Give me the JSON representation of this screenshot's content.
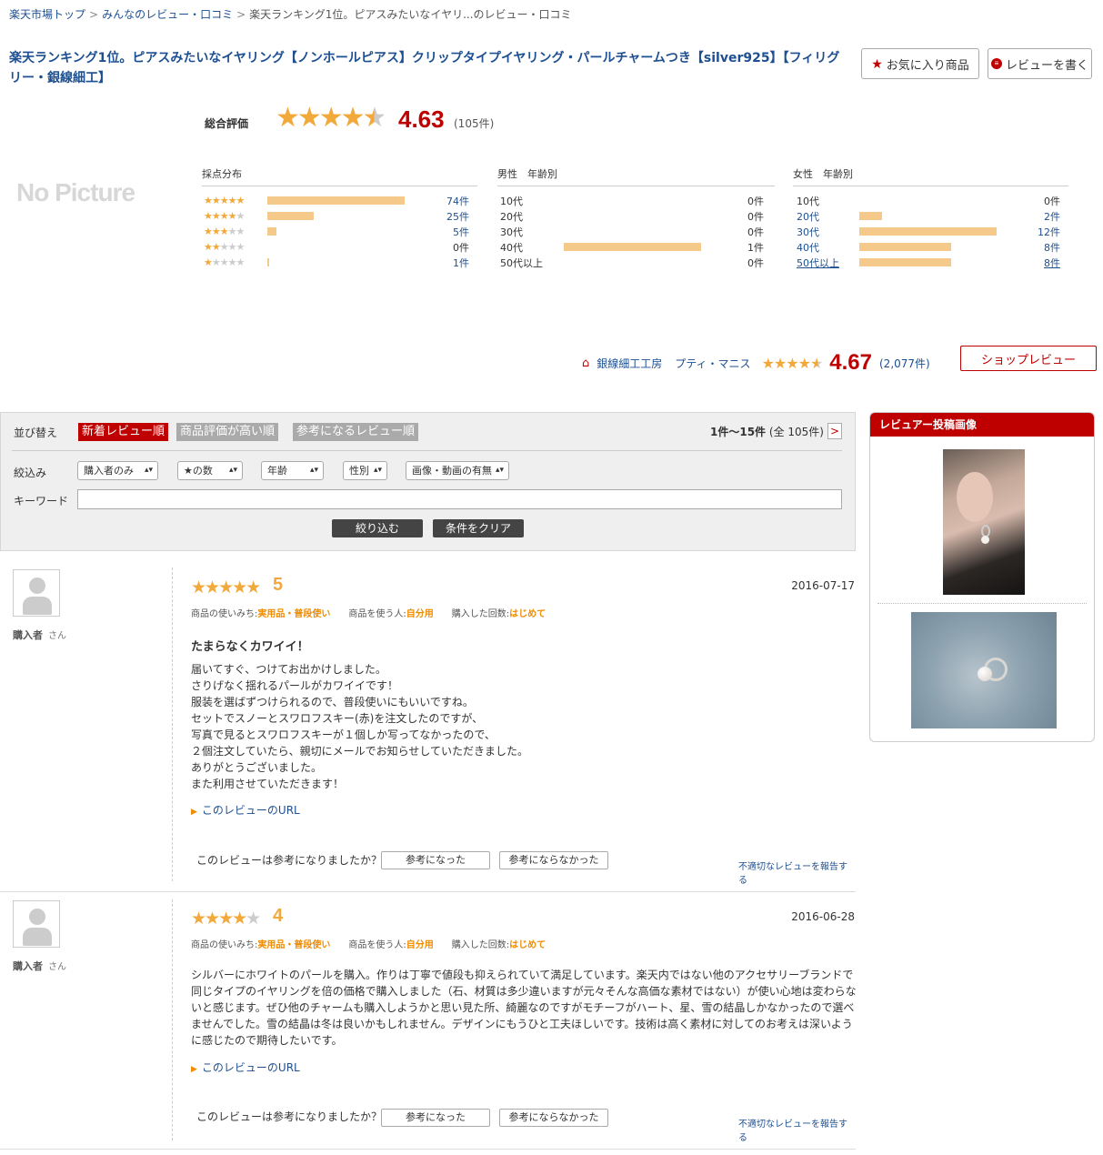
{
  "breadcrumb": {
    "home": "楽天市場トップ",
    "reviews": "みんなのレビュー・口コミ",
    "current": "楽天ランキング1位。ピアスみたいなイヤリ...のレビュー・口コミ",
    "separator": ">"
  },
  "product": {
    "title": "楽天ランキング1位。ピアスみたいなイヤリング【ノンホールピアス】クリップタイプイヤリング・パールチャームつき【silver925】【フィリグリー・銀線細工】",
    "no_picture": "No Picture",
    "fav_label": "お気に入り商品",
    "write_label": "レビューを書く"
  },
  "overall": {
    "label": "総合評価",
    "rating": 4.63,
    "score_text": "4.63",
    "count_text": "(105件)"
  },
  "distribution": {
    "title": "採点分布",
    "rows": [
      {
        "stars": 5,
        "count": "74件",
        "value": 74
      },
      {
        "stars": 4,
        "count": "25件",
        "value": 25
      },
      {
        "stars": 3,
        "count": "5件",
        "value": 5
      },
      {
        "stars": 2,
        "count": "0件",
        "value": 0
      },
      {
        "stars": 1,
        "count": "1件",
        "value": 1
      }
    ]
  },
  "male": {
    "title": "男性　年齢別",
    "rows": [
      {
        "age": "10代",
        "count": "0件",
        "value": 0
      },
      {
        "age": "20代",
        "count": "0件",
        "value": 0
      },
      {
        "age": "30代",
        "count": "0件",
        "value": 0
      },
      {
        "age": "40代",
        "count": "1件",
        "value": 1
      },
      {
        "age": "50代以上",
        "count": "0件",
        "value": 0
      }
    ]
  },
  "female": {
    "title": "女性　年齢別",
    "rows": [
      {
        "age": "10代",
        "count": "0件",
        "value": 0
      },
      {
        "age": "20代",
        "count": "2件",
        "value": 2
      },
      {
        "age": "30代",
        "count": "12件",
        "value": 12
      },
      {
        "age": "40代",
        "count": "8件",
        "value": 8
      },
      {
        "age": "50代以上",
        "count": "8件",
        "value": 8
      }
    ]
  },
  "shop": {
    "name": "銀線細工工房",
    "sub_name": "プティ・マニス",
    "score": "4.67",
    "count": "(2,077件)",
    "review_button": "ショップレビュー"
  },
  "filters": {
    "sort_label": "並び替え",
    "sort_options": [
      "新着レビュー順",
      "商品評価が高い順",
      "参考になるレビュー順"
    ],
    "range": "1件〜15件",
    "range_total": "(全 105件)",
    "next": ">",
    "narrow_label": "絞込み",
    "selects": [
      "購入者のみ",
      "★の数",
      "年齢",
      "性別",
      "画像・動画の有無"
    ],
    "keyword_label": "キーワード",
    "keyword_value": "",
    "apply_button": "絞り込む",
    "clear_button": "条件をクリア"
  },
  "reviews": [
    {
      "reviewer": "購入者",
      "san": "さん",
      "rating": 5,
      "score": "5",
      "date": "2016-07-17",
      "usage_label": "商品の使いみち:",
      "usage": "実用品・普段使い",
      "user_label": "商品を使う人:",
      "user": "自分用",
      "times_label": "購入した回数:",
      "times": "はじめて",
      "title": "たまらなくカワイイ！",
      "body": [
        "届いてすぐ、つけてお出かけしました。",
        "さりげなく揺れるパールがカワイイです！",
        "服装を選ばずつけられるので、普段使いにもいいですね。",
        "セットでスノーとスワロフスキー(赤)を注文したのですが、",
        "写真で見るとスワロフスキーが１個しか写ってなかったので、",
        "２個注文していたら、親切にメールでお知らせしていただきました。",
        "ありがとうございました。",
        "また利用させていただきます！"
      ],
      "url_label": "このレビューのURL",
      "helpful_q": "このレビューは参考になりましたか？",
      "helpful_yes": "参考になった",
      "helpful_no": "参考にならなかった",
      "report": "不適切なレビューを報告する"
    },
    {
      "reviewer": "購入者",
      "san": "さん",
      "rating": 4,
      "score": "4",
      "date": "2016-06-28",
      "usage_label": "商品の使いみち:",
      "usage": "実用品・普段使い",
      "user_label": "商品を使う人:",
      "user": "自分用",
      "times_label": "購入した回数:",
      "times": "はじめて",
      "title": "",
      "body": [
        "シルバーにホワイトのパールを購入。作りは丁寧で値段も抑えられていて満足しています。楽天内ではない他のアクセサリーブランドで同じタイプのイヤリングを倍の価格で購入しました（石、材質は多少違いますが元々そんな高価な素材ではない）が使い心地は変わらないと感じます。ぜひ他のチャームも購入しようかと思い見た所、綺麗なのですがモチーフがハート、星、雪の結晶しかなかったので選べませんでした。雪の結晶は冬は良いかもしれません。デザインにもうひと工夫ほしいです。技術は高く素材に対してのお考えは深いように感じたので期待したいです。"
      ],
      "url_label": "このレビューのURL",
      "helpful_q": "このレビューは参考になりましたか？",
      "helpful_yes": "参考になった",
      "helpful_no": "参考にならなかった",
      "report": "不適切なレビューを報告する"
    }
  ],
  "image_panel": {
    "title": "レビュアー投稿画像"
  },
  "colors": {
    "brand_red": "#bf0000",
    "link_blue": "#1d4f91",
    "star_orange": "#f2a93b",
    "bar_orange": "#f5c98a"
  }
}
